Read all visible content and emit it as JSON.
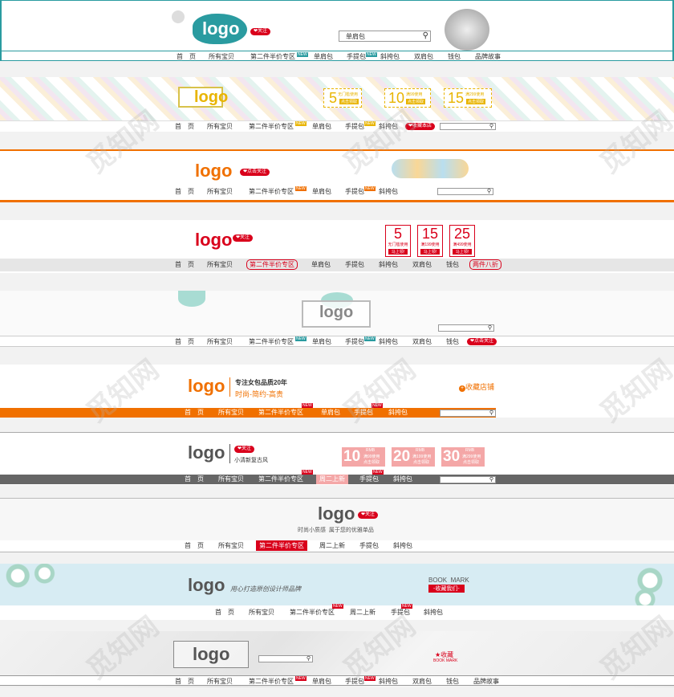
{
  "watermark": "觅知网",
  "b1": {
    "logo": "logo",
    "follow": "关注",
    "search_value": "单肩包",
    "nav": [
      "首　页",
      "所有宝贝",
      "第二件半价专区",
      "单肩包",
      "手提包",
      "斜挎包",
      "双肩包",
      "钱包",
      "品牌故事"
    ],
    "hot": "NEW"
  },
  "b2": {
    "logo": "logo",
    "coupons": [
      {
        "amount": "5",
        "line1": "无门槛使用",
        "btn": "点击领取"
      },
      {
        "amount": "10",
        "line1": "满99使用",
        "btn": "点击领取"
      },
      {
        "amount": "15",
        "line1": "满299使用",
        "btn": "点击领取"
      }
    ],
    "nav": [
      "首　页",
      "所有宝贝",
      "第二件半价专区",
      "单肩包",
      "手提包",
      "斜挎包"
    ],
    "fav": "收藏本店"
  },
  "b3": {
    "logo": "logo",
    "follow": "点击关注",
    "nav": [
      "首　页",
      "所有宝贝",
      "第二件半价专区",
      "单肩包",
      "手提包",
      "斜挎包"
    ]
  },
  "b4": {
    "logo": "logo",
    "follow": "关注",
    "coupons": [
      {
        "amount": "5",
        "line1": "无门槛使用",
        "btn": "马上领!"
      },
      {
        "amount": "15",
        "line1": "满199使用",
        "btn": "马上领!"
      },
      {
        "amount": "25",
        "line1": "满499使用",
        "btn": "马上领!"
      }
    ],
    "nav": [
      "首　页",
      "所有宝贝",
      "第二件半价专区",
      "单肩包",
      "手提包",
      "斜挎包",
      "双肩包",
      "钱包",
      "两件八折"
    ]
  },
  "b5": {
    "logo": "logo",
    "nav": [
      "首　页",
      "所有宝贝",
      "第二件半价专区",
      "单肩包",
      "手提包",
      "斜挎包",
      "双肩包",
      "钱包"
    ],
    "follow": "点击关注"
  },
  "b6": {
    "logo": "logo",
    "tag1": "专注女包品质20年",
    "tag2": "时尚-简约-高贵",
    "fav": "收藏店铺",
    "nav": [
      "首　页",
      "所有宝贝",
      "第二件半价专区",
      "单肩包",
      "手提包",
      "斜挎包"
    ]
  },
  "b7": {
    "logo": "logo",
    "follow": "关注",
    "slogan": "小清新复古风",
    "coupons": [
      {
        "amount": "10",
        "unit": "RMB",
        "line1": "满99使用",
        "btn": "点击领取"
      },
      {
        "amount": "20",
        "unit": "RMB",
        "line1": "满199使用",
        "btn": "点击领取"
      },
      {
        "amount": "30",
        "unit": "RMB",
        "line1": "满299使用",
        "btn": "点击领取"
      }
    ],
    "nav": [
      "首　页",
      "所有宝贝",
      "第二件半价专区",
      "周二上新",
      "手提包",
      "斜挎包"
    ]
  },
  "b8": {
    "logo": "logo",
    "follow": "关注",
    "slogan": "时尚小质感  属于您的优雅单品",
    "nav": [
      "首　页",
      "所有宝贝",
      "第二件半价专区",
      "周二上新",
      "手提包",
      "斜挎包"
    ]
  },
  "b9": {
    "logo": "logo",
    "slogan": "用心打造原创设计师品牌",
    "bm_title": "BOOK  MARK",
    "bm_btn": "-收藏我们-",
    "nav": [
      "首　页",
      "所有宝贝",
      "第二件半价专区",
      "周二上新",
      "手提包",
      "斜挎包"
    ]
  },
  "b10": {
    "logo": "logo",
    "fav": "收藏",
    "bm": "BOOK MARK",
    "nav": [
      "首　页",
      "所有宝贝",
      "第二件半价专区",
      "单肩包",
      "手提包",
      "斜挎包",
      "双肩包",
      "钱包",
      "品牌故事"
    ]
  },
  "colors": {
    "red": "#d9001b",
    "orange": "#f07000",
    "teal": "#2a9ba0",
    "gray": "#666666"
  }
}
